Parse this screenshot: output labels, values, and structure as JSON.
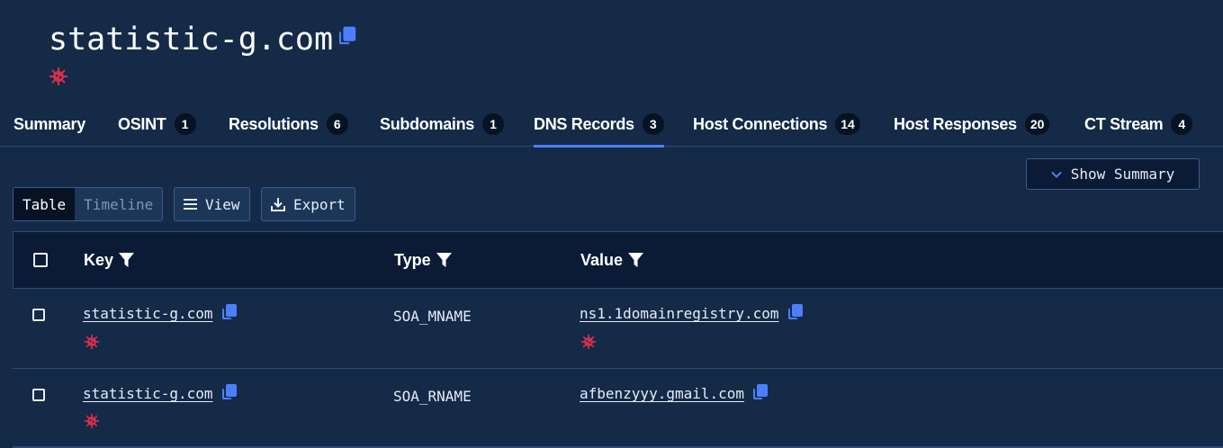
{
  "header": {
    "title": "statistic-g.com",
    "copy_icon": "copy-icon",
    "threat_icon": "virus-icon"
  },
  "tabs": [
    {
      "label": "Summary",
      "count": ""
    },
    {
      "label": "OSINT",
      "count": "1"
    },
    {
      "label": "Resolutions",
      "count": "6"
    },
    {
      "label": "Subdomains",
      "count": "1"
    },
    {
      "label": "DNS Records",
      "count": "3",
      "active": true
    },
    {
      "label": "Host Connections",
      "count": "14"
    },
    {
      "label": "Host Responses",
      "count": "20"
    },
    {
      "label": "CT Stream",
      "count": "4"
    }
  ],
  "show_summary_label": "Show Summary",
  "toolbar": {
    "table_label": "Table",
    "timeline_label": "Timeline",
    "view_label": "View",
    "export_label": "Export"
  },
  "table": {
    "columns": [
      "Key",
      "Type",
      "Value"
    ],
    "rows": [
      {
        "key": "statistic-g.com",
        "key_flag": true,
        "type": "SOA_MNAME",
        "value": "ns1.1domainregistry.com",
        "value_flag": true
      },
      {
        "key": "statistic-g.com",
        "key_flag": true,
        "type": "SOA_RNAME",
        "value": "afbenzyyy.gmail.com",
        "value_flag": false
      }
    ]
  },
  "colors": {
    "background": "#142a47",
    "accent": "#4c7fff",
    "threat": "#d6304a",
    "badge": "#071224"
  }
}
